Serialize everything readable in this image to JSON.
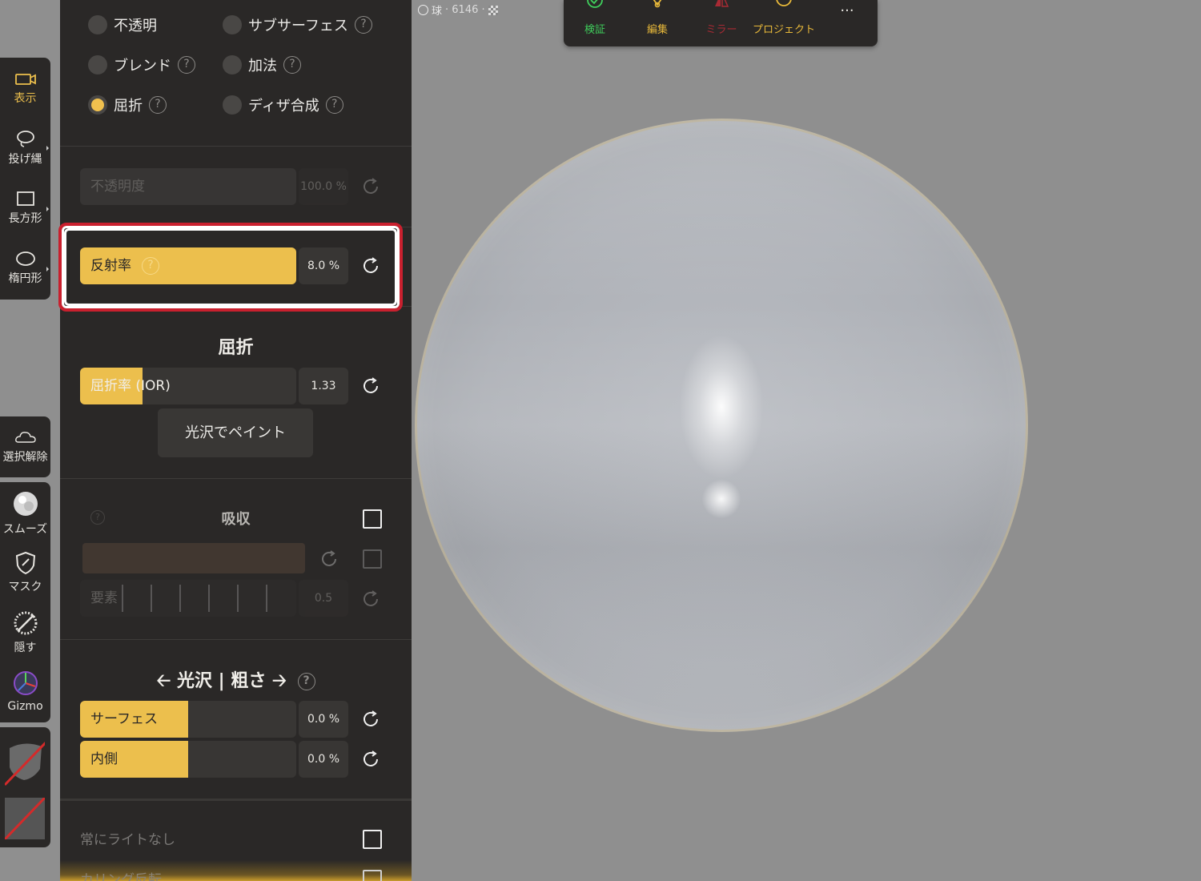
{
  "object_info": {
    "name": "球",
    "polycount": "· 6146 ·"
  },
  "top_toolbar": {
    "items": [
      {
        "label": "検証",
        "color": "#3fcf5c",
        "icon": "check-circle-icon"
      },
      {
        "label": "編集",
        "color": "#e8b93a",
        "icon": "edit-node-icon"
      },
      {
        "label": "ミラー",
        "color": "#a82a34",
        "icon": "mirror-icon"
      },
      {
        "label": "プロジェクト",
        "color": "#e8b93a",
        "icon": "project-icon"
      }
    ],
    "more_label": "..."
  },
  "left_tools": {
    "group1": [
      {
        "label": "表示",
        "icon": "camera-icon",
        "active": true
      },
      {
        "label": "投げ縄",
        "icon": "lasso-icon"
      },
      {
        "label": "長方形",
        "icon": "rectangle-icon"
      },
      {
        "label": "楕円形",
        "icon": "ellipse-icon"
      }
    ],
    "deselect_label": "選択解除",
    "group2": [
      {
        "label": "スムーズ",
        "icon": "smooth-icon"
      },
      {
        "label": "マスク",
        "icon": "mask-icon"
      },
      {
        "label": "隠す",
        "icon": "hide-icon"
      },
      {
        "label": "Gizmo",
        "icon": "gizmo-icon"
      }
    ]
  },
  "panel": {
    "blend_modes": [
      {
        "label": "不透明",
        "selected": false,
        "help": false
      },
      {
        "label": "サブサーフェス",
        "selected": false,
        "help": true
      },
      {
        "label": "ブレンド",
        "selected": false,
        "help": true
      },
      {
        "label": "加法",
        "selected": false,
        "help": true
      },
      {
        "label": "屈折",
        "selected": true,
        "help": true
      },
      {
        "label": "ディザ合成",
        "selected": false,
        "help": true
      }
    ],
    "opacity": {
      "label": "不透明度",
      "value": "100.0 %",
      "fraction": 1.0
    },
    "reflectance": {
      "label": "反射率",
      "value": "8.0 %",
      "fraction": 1.0
    },
    "refraction": {
      "title": "屈折",
      "ior_label": "屈折率 (IOR)",
      "ior_value": "1.33",
      "ior_fraction": 0.29,
      "paint_button": "光沢でペイント"
    },
    "absorption": {
      "title": "吸収",
      "factor_label": "要素",
      "factor_value": "0.5"
    },
    "gloss": {
      "title": "光沢 | 粗さ",
      "surface": {
        "label": "サーフェス",
        "value": "0.0 %",
        "fraction": 0.5
      },
      "inner": {
        "label": "内側",
        "value": "0.0 %",
        "fraction": 0.5
      }
    },
    "always_unlit_label": "常にライトなし",
    "culling_label": "カリング反転"
  },
  "help_glyph": "?"
}
